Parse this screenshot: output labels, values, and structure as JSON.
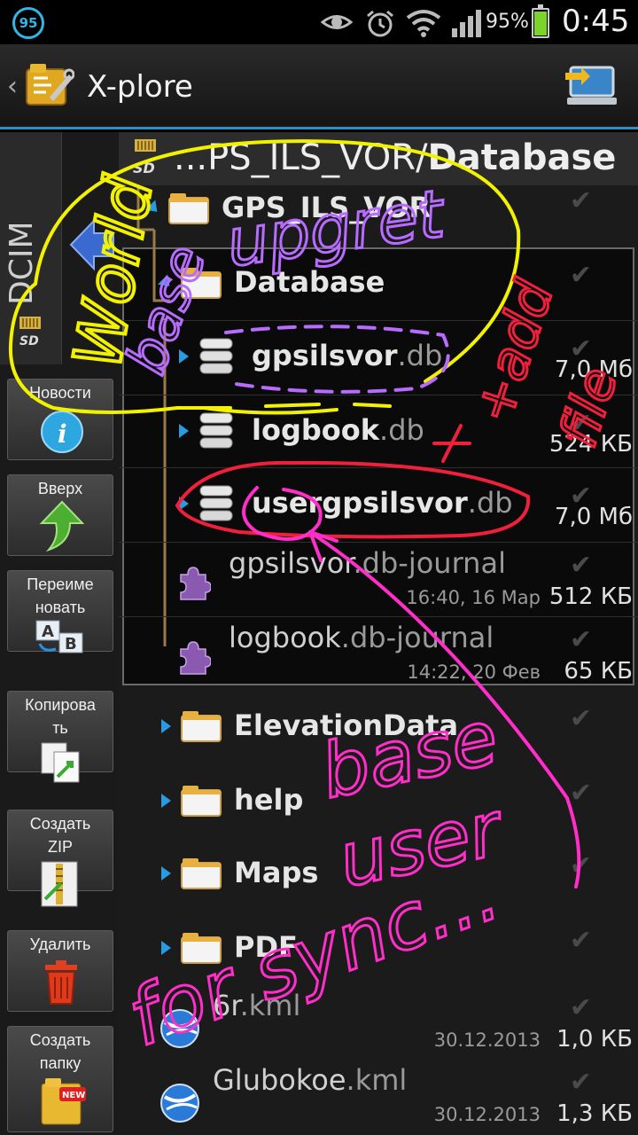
{
  "status": {
    "badge": "95",
    "battery_pct": "95%",
    "battery_level": 0.95,
    "time": "0:45",
    "icons": [
      "eye-icon",
      "alarm-icon",
      "wifi-icon",
      "signal-icon",
      "battery-icon"
    ]
  },
  "app": {
    "title": "X-plore"
  },
  "left": {
    "tab_label": "DCIM",
    "tools": [
      {
        "label": "Новости",
        "icon": "info-icon"
      },
      {
        "label": "Вверх",
        "icon": "up-arrow-icon"
      },
      {
        "label": "Переиме\nновать",
        "icon": "rename-icon"
      },
      {
        "label": "Копирова\nть",
        "icon": "copy-icon"
      },
      {
        "label": "Создать\nZIP",
        "icon": "zip-icon"
      },
      {
        "label": "Удалить",
        "icon": "trash-icon"
      },
      {
        "label": "Создать\nпапку",
        "icon": "new-folder-icon"
      }
    ]
  },
  "path": {
    "prefix": "...PS_ILS_VOR/",
    "current": "Database"
  },
  "tree": [
    {
      "name": "GPS_ILS_VOR",
      "ext": "",
      "type": "folder",
      "size": "",
      "date": ""
    },
    {
      "name": "Database",
      "ext": "",
      "type": "folder",
      "size": "",
      "date": ""
    },
    {
      "name": "gpsilsvor",
      "ext": ".db",
      "type": "db",
      "size": "7,0 Мб",
      "date": ""
    },
    {
      "name": "logbook",
      "ext": ".db",
      "type": "db",
      "size": "524 КБ",
      "date": ""
    },
    {
      "name": "usergpsilsvor",
      "ext": ".db",
      "type": "db",
      "size": "7,0 Мб",
      "date": ""
    },
    {
      "name": "gpsilsvor",
      "ext": ".db-journal",
      "type": "journal",
      "size": "512 КБ",
      "date": "16:40, 16 Мар"
    },
    {
      "name": "logbook",
      "ext": ".db-journal",
      "type": "journal",
      "size": "65 КБ",
      "date": "14:22, 20 Фев"
    },
    {
      "name": "ElevationData",
      "ext": "",
      "type": "folder",
      "size": "",
      "date": ""
    },
    {
      "name": "help",
      "ext": "",
      "type": "folder",
      "size": "",
      "date": ""
    },
    {
      "name": "Maps",
      "ext": "",
      "type": "folder",
      "size": "",
      "date": ""
    },
    {
      "name": "PDF",
      "ext": "",
      "type": "folder",
      "size": "",
      "date": ""
    },
    {
      "name": "6r",
      "ext": ".kml",
      "type": "kml",
      "size": "1,0 КБ",
      "date": "30.12.2013"
    },
    {
      "name": "Glubokoe",
      "ext": ".kml",
      "type": "kml",
      "size": "1,3 КБ",
      "date": "30.12.2013"
    }
  ],
  "annotations": {
    "yellow": "World base",
    "purple": "upgret",
    "red": "+ add file",
    "pink_1": "base",
    "pink_2": "user",
    "pink_3": "for sync ...",
    "colors": {
      "yellow": "#f2f200",
      "purple": "#b86cff",
      "red": "#f0203c",
      "pink": "#ff2ec8"
    }
  },
  "colors": {
    "accent": "#2a9be0",
    "background": "#1b1b1b"
  }
}
